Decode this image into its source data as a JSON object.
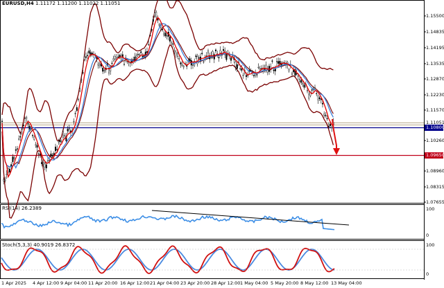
{
  "header": {
    "symbol": "EURUSD,H4",
    "ohlc": "1.11172 1.11200 1.11022 1.11051"
  },
  "price_axis": {
    "labels": [
      "1.15500",
      "1.14835",
      "1.14195",
      "1.13535",
      "1.12870",
      "1.12230",
      "1.11570",
      "1.10260",
      "1.08960",
      "1.08315",
      "1.07655"
    ]
  },
  "tags": {
    "current": {
      "text": "1.11051",
      "color": "#000000"
    },
    "support_blue": {
      "text": "1.10800",
      "color": "#00008b"
    },
    "support_red": {
      "text": "1.09650",
      "color": "#c0001a"
    }
  },
  "rsi": {
    "title": "RSI(14) 26.2389",
    "levels": [
      "100",
      "0"
    ]
  },
  "stoch": {
    "title": "Stoch(5,3,3) 40.9019 26.8372",
    "levels": [
      "100",
      "0"
    ]
  },
  "time_axis": {
    "labels": [
      "1 Apr 2025",
      "4 Apr 12:00",
      "9 Apr 04:00",
      "11 Apr 20:00",
      "16 Apr 12:00",
      "21 Apr 04:00",
      "23 Apr 20:00",
      "28 Apr 12:00",
      "1 May 04:00",
      "5 May 20:00",
      "8 May 12:00",
      "13 May 04:00"
    ]
  },
  "colors": {
    "bollinger": "#7a0000",
    "ma_fast": "#e00000",
    "ma_slow": "#3c7fd8",
    "candles": "#000000",
    "rsi_line": "#3c8ee6",
    "rsi_trend": "#000000",
    "stoch_main": "#d01010",
    "stoch_signal": "#4a8ae0",
    "arrow": "#e01010"
  }
}
